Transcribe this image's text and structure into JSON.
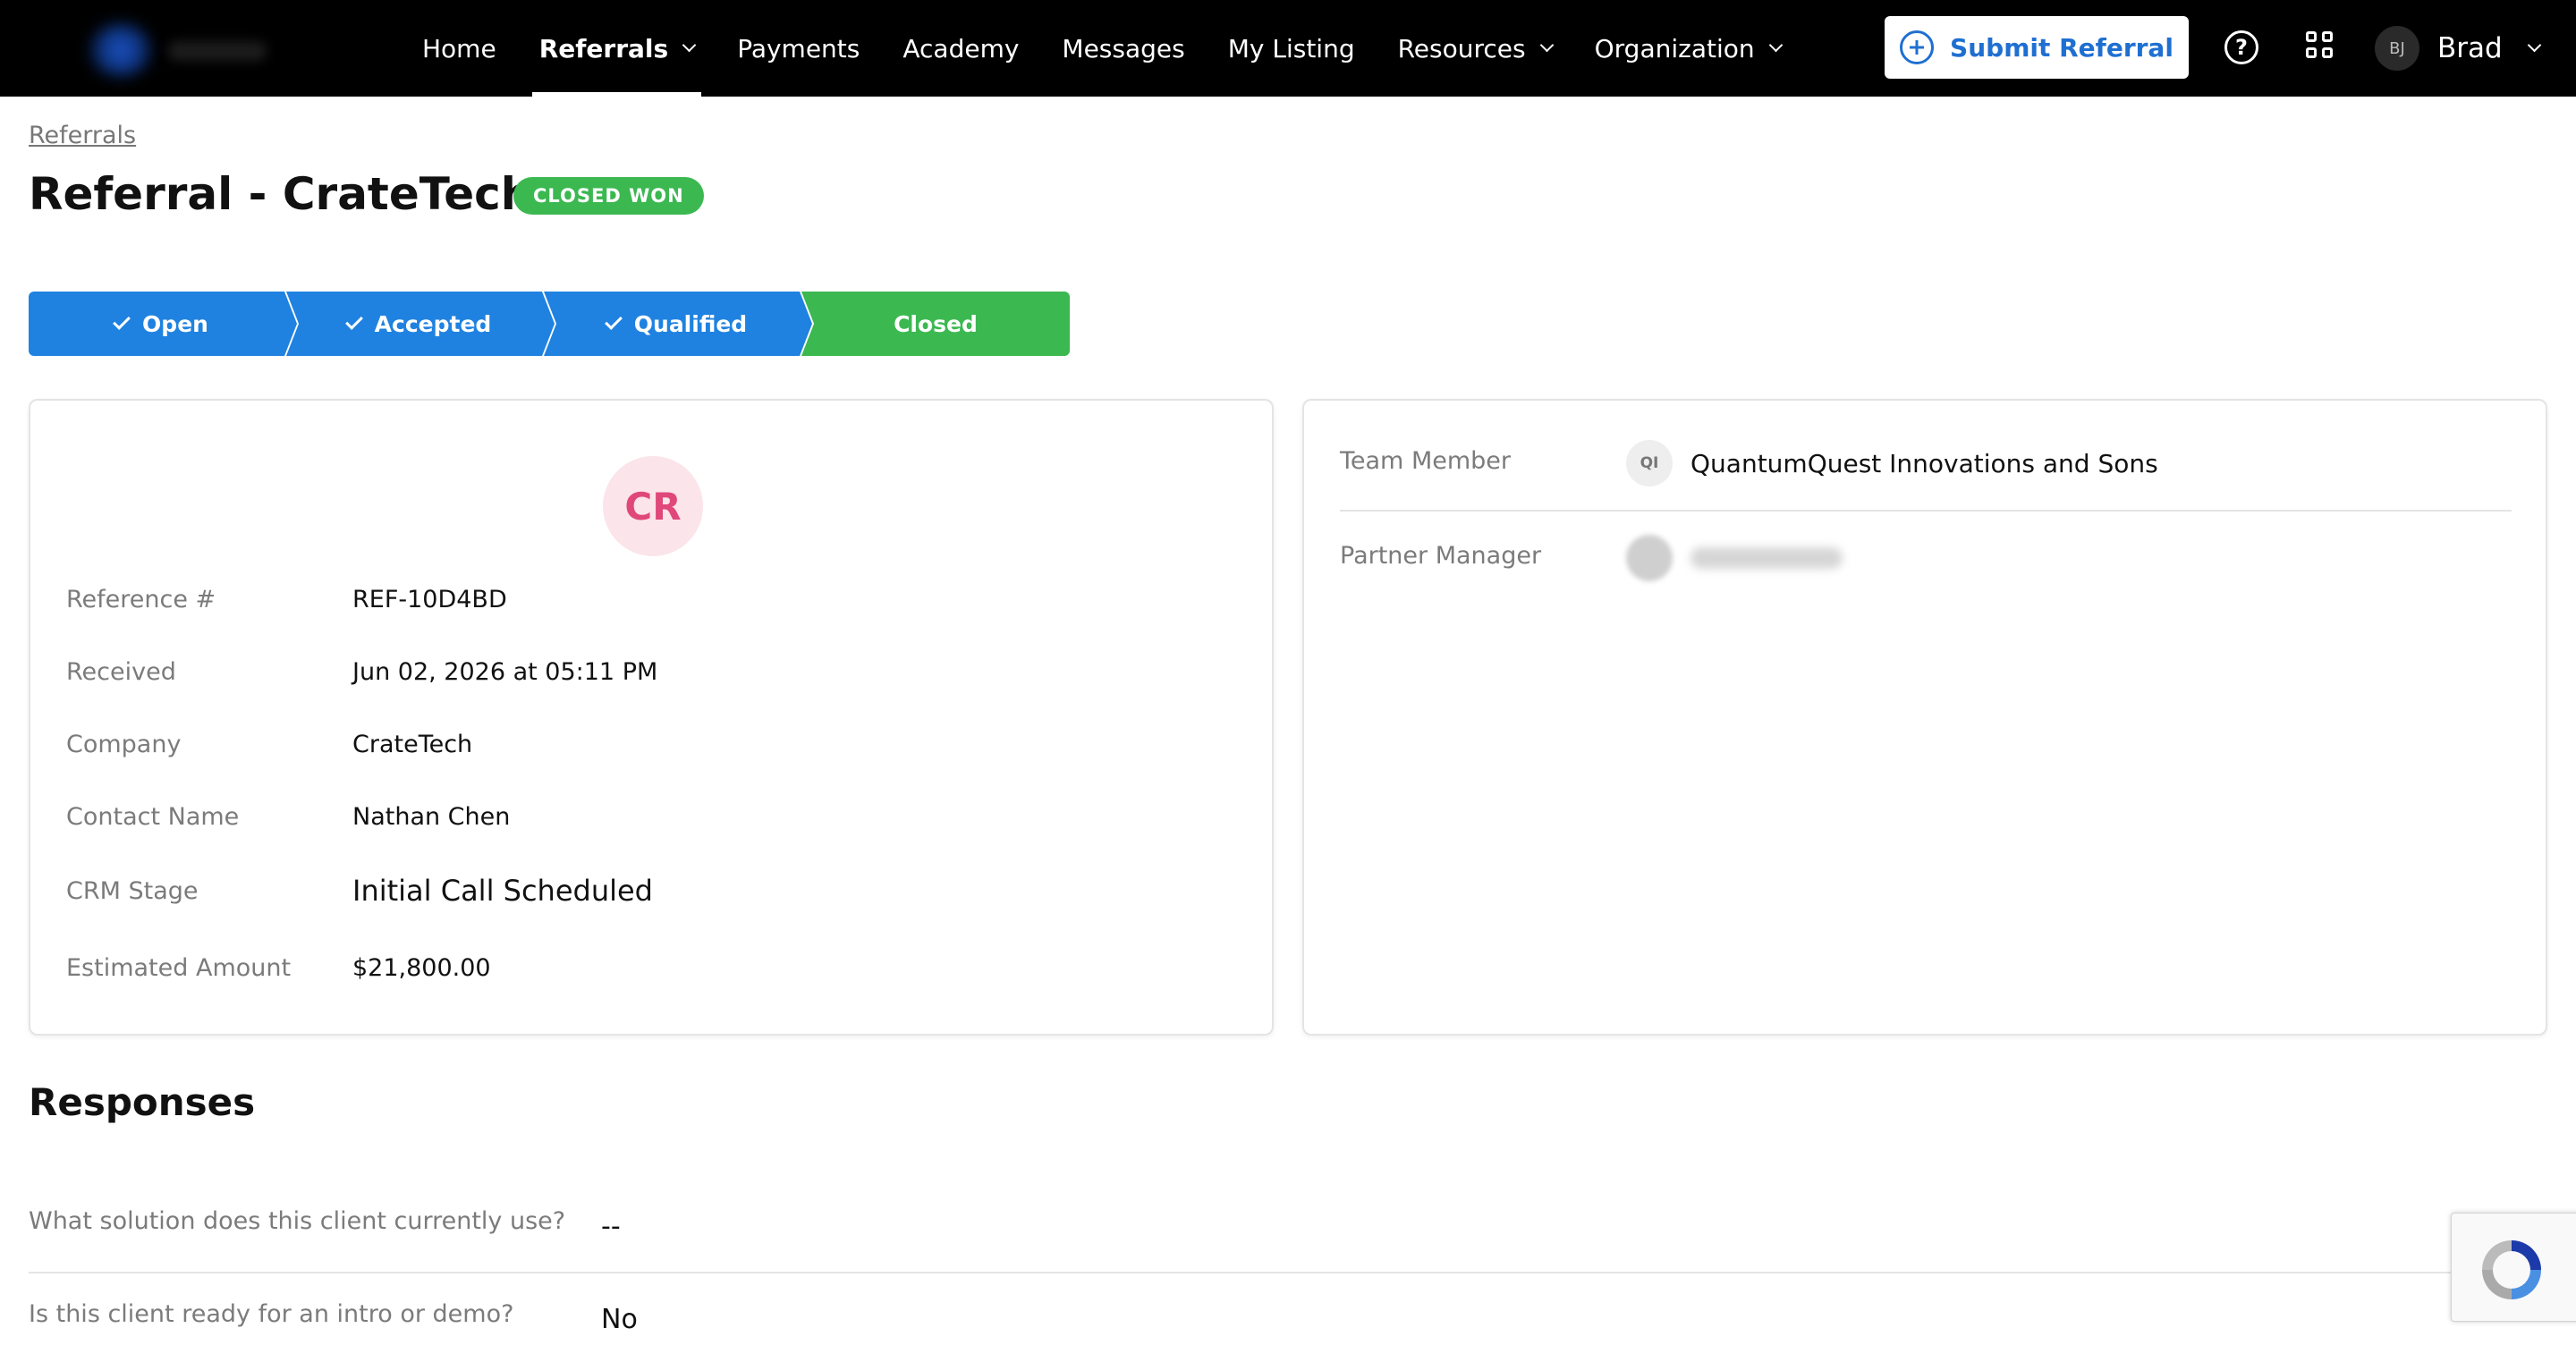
{
  "nav": {
    "items": [
      {
        "label": "Home"
      },
      {
        "label": "Referrals"
      },
      {
        "label": "Payments"
      },
      {
        "label": "Academy"
      },
      {
        "label": "Messages"
      },
      {
        "label": "My Listing"
      },
      {
        "label": "Resources"
      },
      {
        "label": "Organization"
      }
    ],
    "submit_label": "Submit Referral",
    "help_glyph": "?",
    "user_initials": "BJ",
    "user_name": "Brad"
  },
  "breadcrumb": "Referrals",
  "page_title": "Referral - CrateTech",
  "status_badge": "CLOSED WON",
  "stepper": [
    {
      "label": "Open",
      "done": true
    },
    {
      "label": "Accepted",
      "done": true
    },
    {
      "label": "Qualified",
      "done": true
    },
    {
      "label": "Closed",
      "done": false
    }
  ],
  "colors": {
    "step_done": "#1f82e0",
    "step_current": "#3cb851",
    "accent": "#1f6fd1"
  },
  "details": {
    "avatar_initials": "CR",
    "fields": [
      {
        "label": "Reference #",
        "value": "REF-10D4BD"
      },
      {
        "label": "Received",
        "value": "Jun 02, 2026 at 05:11 PM"
      },
      {
        "label": "Company",
        "value": "CrateTech"
      },
      {
        "label": "Contact Name",
        "value": "Nathan Chen"
      },
      {
        "label": "CRM Stage",
        "value": "Initial Call Scheduled"
      },
      {
        "label": "Estimated Amount",
        "value": "$21,800.00"
      }
    ]
  },
  "team": {
    "team_member_label": "Team Member",
    "team_member_initials": "QI",
    "team_member_name": "QuantumQuest Innovations and Sons",
    "partner_manager_label": "Partner Manager"
  },
  "responses": {
    "title": "Responses",
    "items": [
      {
        "question": "What solution does this client currently use?",
        "answer": "--"
      },
      {
        "question": "Is this client ready for an intro or demo?",
        "answer": "No"
      }
    ]
  }
}
